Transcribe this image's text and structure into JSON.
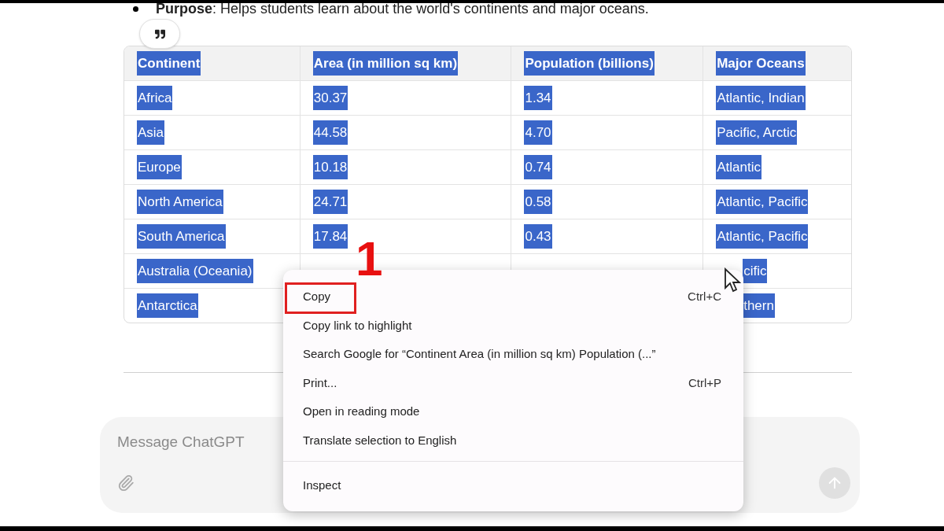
{
  "message": {
    "bullet": "**Purpose**: Helps students learn about the world's continents and major oceans."
  },
  "table": {
    "columns": [
      {
        "text": "Continent",
        "selected": true
      },
      {
        "text": "Area (in million sq km)",
        "selected": true
      },
      {
        "text": "Population (billions)",
        "selected": true
      },
      {
        "text": "Major Oceans",
        "selected": true
      }
    ],
    "rows": [
      {
        "cells": [
          {
            "text": "Africa",
            "selected": true
          },
          {
            "text": "30.37",
            "selected": true
          },
          {
            "text": "1.34",
            "selected": true
          },
          {
            "text": "Atlantic, Indian",
            "selected": true
          }
        ]
      },
      {
        "cells": [
          {
            "text": "Asia",
            "selected": true
          },
          {
            "text": "44.58",
            "selected": true
          },
          {
            "text": "4.70",
            "selected": true
          },
          {
            "text": "Pacific, Arctic",
            "selected": true
          }
        ]
      },
      {
        "cells": [
          {
            "text": "Europe",
            "selected": true
          },
          {
            "text": "10.18",
            "selected": true
          },
          {
            "text": "0.74",
            "selected": true
          },
          {
            "text": "Atlantic",
            "selected": true
          }
        ]
      },
      {
        "cells": [
          {
            "text": "North America",
            "selected": true
          },
          {
            "text": "24.71",
            "selected": true
          },
          {
            "text": "0.58",
            "selected": true
          },
          {
            "text": "Atlantic, Pacific",
            "selected": true
          }
        ]
      },
      {
        "cells": [
          {
            "text": "South America",
            "selected": true
          },
          {
            "text": "17.84",
            "selected": true
          },
          {
            "text": "0.43",
            "selected": true
          },
          {
            "text": "Atlantic, Pacific",
            "selected": true
          }
        ]
      },
      {
        "cells": [
          {
            "text": "Australia (Oceania)",
            "selected": true
          },
          {},
          {},
          {
            "text": "cific",
            "selected": true,
            "partial": true
          }
        ]
      },
      {
        "cells": [
          {
            "text": "Antarctica",
            "selected": true
          },
          {},
          {},
          {
            "text": "thern",
            "selected": true,
            "partial": true
          }
        ]
      }
    ]
  },
  "context_menu": {
    "groups": [
      [
        {
          "label": "Copy",
          "shortcut": "Ctrl+C",
          "annotated": true
        },
        {
          "label": "Copy link to highlight",
          "annotated": false
        },
        {
          "label": "Search Google for “Continent Area (in million sq km) Population (...”",
          "annotated": false
        },
        {
          "label": "Print...",
          "shortcut": "Ctrl+P",
          "annotated": false
        },
        {
          "label": "Open in reading mode",
          "annotated": false
        },
        {
          "label": "Translate selection to English",
          "annotated": false
        }
      ],
      [
        {
          "label": "Inspect",
          "annotated": false
        }
      ]
    ]
  },
  "annotation": {
    "step": "1"
  },
  "composer": {
    "placeholder": "Message ChatGPT",
    "send_disabled": true
  }
}
